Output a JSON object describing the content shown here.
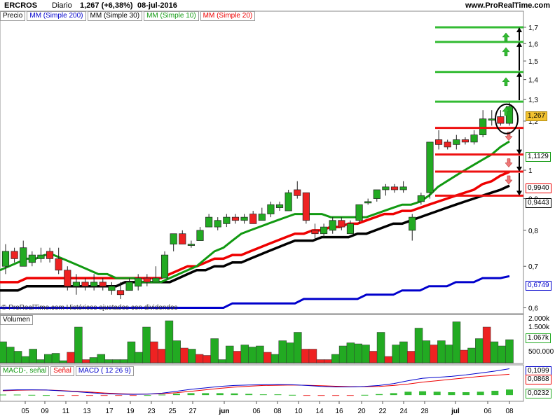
{
  "header": {
    "symbol": "ERCROS",
    "period": "Diario",
    "change": "1,267 (+6,38%)",
    "date": "08-jul-2016",
    "site": "www.ProRealTime.com"
  },
  "legend": {
    "price": "Precio",
    "mm200": "MM (Simple 200)",
    "mm30": "MM (Simple 30)",
    "mm10": "MM (Simple 10)",
    "mm20": "MM (Simple 20)"
  },
  "watermark": "© ProRealTime.com Históricos ajustados con dividendos",
  "volume_label": "Volumen",
  "macd_labels": {
    "a": "MACD-, señal",
    "b": "Señal",
    "c": "MACD ( 12 26 9)"
  },
  "price_tags": {
    "last": "1,267",
    "mm10": "1,1129",
    "mm20": "0,9940",
    "mm30": "0,9443",
    "mm200": "0,6749"
  },
  "volume_tags": [
    "2.000k",
    "1.500k",
    "1.067k",
    "500.000"
  ],
  "macd_tags": [
    "0,1099",
    "0,0868",
    "0,0232"
  ],
  "colors": {
    "up": "#22aa22",
    "down": "#ee2222",
    "mm200": "#0000cc",
    "mm30": "#000000",
    "mm10": "#119911",
    "mm20": "#ee0000",
    "last_tag": "#f2c230"
  },
  "chart_data": {
    "type": "candlestick",
    "title": "ERCROS Diario",
    "ylim": [
      0.59,
      1.74
    ],
    "y_ticks": [
      0.6,
      0.7,
      0.8,
      0.9,
      1.0,
      1.2,
      1.3,
      1.4,
      1.5,
      1.6,
      1.7
    ],
    "y_tick_labels": [
      "0,6",
      "0,7",
      "0,8",
      "0,9",
      "1",
      "1,2",
      "1,3",
      "1,4",
      "1,5",
      "1,6",
      "1,7"
    ],
    "x_labels": [
      "05",
      "09",
      "11",
      "13",
      "17",
      "19",
      "23",
      "25",
      "27",
      "jun",
      "06",
      "08",
      "10",
      "14",
      "16",
      "20",
      "22",
      "24",
      "28",
      "jul",
      "06",
      "08"
    ],
    "candles": [
      {
        "o": 0.7,
        "h": 0.76,
        "l": 0.68,
        "c": 0.74
      },
      {
        "o": 0.74,
        "h": 0.75,
        "l": 0.71,
        "c": 0.72
      },
      {
        "o": 0.7,
        "h": 0.77,
        "l": 0.7,
        "c": 0.75
      },
      {
        "o": 0.71,
        "h": 0.74,
        "l": 0.7,
        "c": 0.73
      },
      {
        "o": 0.72,
        "h": 0.75,
        "l": 0.71,
        "c": 0.73
      },
      {
        "o": 0.74,
        "h": 0.75,
        "l": 0.71,
        "c": 0.72
      },
      {
        "o": 0.72,
        "h": 0.75,
        "l": 0.68,
        "c": 0.69
      },
      {
        "o": 0.69,
        "h": 0.7,
        "l": 0.64,
        "c": 0.65
      },
      {
        "o": 0.65,
        "h": 0.68,
        "l": 0.63,
        "c": 0.66
      },
      {
        "o": 0.66,
        "h": 0.67,
        "l": 0.64,
        "c": 0.65
      },
      {
        "o": 0.65,
        "h": 0.68,
        "l": 0.64,
        "c": 0.66
      },
      {
        "o": 0.66,
        "h": 0.67,
        "l": 0.64,
        "c": 0.65
      },
      {
        "o": 0.64,
        "h": 0.66,
        "l": 0.63,
        "c": 0.65
      },
      {
        "o": 0.64,
        "h": 0.66,
        "l": 0.62,
        "c": 0.63
      },
      {
        "o": 0.64,
        "h": 0.67,
        "l": 0.64,
        "c": 0.66
      },
      {
        "o": 0.65,
        "h": 0.68,
        "l": 0.64,
        "c": 0.67
      },
      {
        "o": 0.67,
        "h": 0.68,
        "l": 0.65,
        "c": 0.66
      },
      {
        "o": 0.66,
        "h": 0.7,
        "l": 0.66,
        "c": 0.67
      },
      {
        "o": 0.67,
        "h": 0.74,
        "l": 0.67,
        "c": 0.73
      },
      {
        "o": 0.76,
        "h": 0.79,
        "l": 0.74,
        "c": 0.79
      },
      {
        "o": 0.79,
        "h": 0.8,
        "l": 0.76,
        "c": 0.76
      },
      {
        "o": 0.76,
        "h": 0.77,
        "l": 0.75,
        "c": 0.76
      },
      {
        "o": 0.77,
        "h": 0.81,
        "l": 0.77,
        "c": 0.8
      },
      {
        "o": 0.81,
        "h": 0.85,
        "l": 0.81,
        "c": 0.84
      },
      {
        "o": 0.81,
        "h": 0.84,
        "l": 0.8,
        "c": 0.83
      },
      {
        "o": 0.82,
        "h": 0.85,
        "l": 0.81,
        "c": 0.84
      },
      {
        "o": 0.84,
        "h": 0.85,
        "l": 0.82,
        "c": 0.83
      },
      {
        "o": 0.83,
        "h": 0.85,
        "l": 0.82,
        "c": 0.84
      },
      {
        "o": 0.85,
        "h": 0.86,
        "l": 0.82,
        "c": 0.82
      },
      {
        "o": 0.83,
        "h": 0.87,
        "l": 0.83,
        "c": 0.85
      },
      {
        "o": 0.85,
        "h": 0.89,
        "l": 0.84,
        "c": 0.88
      },
      {
        "o": 0.87,
        "h": 0.89,
        "l": 0.86,
        "c": 0.88
      },
      {
        "o": 0.86,
        "h": 0.93,
        "l": 0.86,
        "c": 0.92
      },
      {
        "o": 0.93,
        "h": 0.96,
        "l": 0.9,
        "c": 0.91
      },
      {
        "o": 0.92,
        "h": 0.92,
        "l": 0.82,
        "c": 0.83
      },
      {
        "o": 0.8,
        "h": 0.82,
        "l": 0.77,
        "c": 0.79
      },
      {
        "o": 0.79,
        "h": 0.82,
        "l": 0.78,
        "c": 0.81
      },
      {
        "o": 0.8,
        "h": 0.84,
        "l": 0.79,
        "c": 0.83
      },
      {
        "o": 0.83,
        "h": 0.84,
        "l": 0.8,
        "c": 0.81
      },
      {
        "o": 0.79,
        "h": 0.83,
        "l": 0.79,
        "c": 0.82
      },
      {
        "o": 0.83,
        "h": 0.88,
        "l": 0.82,
        "c": 0.88
      },
      {
        "o": 0.89,
        "h": 0.9,
        "l": 0.88,
        "c": 0.89
      },
      {
        "o": 0.9,
        "h": 0.93,
        "l": 0.89,
        "c": 0.93
      },
      {
        "o": 0.93,
        "h": 0.95,
        "l": 0.91,
        "c": 0.94
      },
      {
        "o": 0.94,
        "h": 0.95,
        "l": 0.92,
        "c": 0.93
      },
      {
        "o": 0.93,
        "h": 0.96,
        "l": 0.92,
        "c": 0.94
      },
      {
        "o": 0.8,
        "h": 0.85,
        "l": 0.77,
        "c": 0.84
      },
      {
        "o": 0.89,
        "h": 0.92,
        "l": 0.88,
        "c": 0.91
      },
      {
        "o": 0.92,
        "h": 1.11,
        "l": 0.9,
        "c": 1.11
      },
      {
        "o": 1.12,
        "h": 1.16,
        "l": 1.08,
        "c": 1.1
      },
      {
        "o": 1.11,
        "h": 1.12,
        "l": 1.08,
        "c": 1.09
      },
      {
        "o": 1.1,
        "h": 1.14,
        "l": 1.08,
        "c": 1.12
      },
      {
        "o": 1.12,
        "h": 1.13,
        "l": 1.1,
        "c": 1.11
      },
      {
        "o": 1.11,
        "h": 1.16,
        "l": 1.1,
        "c": 1.14
      },
      {
        "o": 1.14,
        "h": 1.25,
        "l": 1.13,
        "c": 1.21
      },
      {
        "o": 1.21,
        "h": 1.25,
        "l": 1.18,
        "c": 1.21
      },
      {
        "o": 1.22,
        "h": 1.25,
        "l": 1.18,
        "c": 1.19
      },
      {
        "o": 1.19,
        "h": 1.29,
        "l": 1.18,
        "c": 1.267
      }
    ],
    "mm10": [
      0.69,
      0.7,
      0.71,
      0.72,
      0.72,
      0.73,
      0.73,
      0.72,
      0.71,
      0.7,
      0.69,
      0.68,
      0.68,
      0.67,
      0.67,
      0.67,
      0.66,
      0.66,
      0.66,
      0.67,
      0.68,
      0.69,
      0.7,
      0.72,
      0.74,
      0.75,
      0.77,
      0.79,
      0.8,
      0.81,
      0.82,
      0.83,
      0.84,
      0.85,
      0.85,
      0.85,
      0.85,
      0.84,
      0.84,
      0.84,
      0.84,
      0.84,
      0.85,
      0.86,
      0.87,
      0.88,
      0.88,
      0.89,
      0.91,
      0.94,
      0.96,
      0.98,
      1.0,
      1.02,
      1.04,
      1.06,
      1.09,
      1.1129
    ],
    "mm20": [
      0.66,
      0.66,
      0.66,
      0.67,
      0.67,
      0.67,
      0.67,
      0.67,
      0.67,
      0.67,
      0.67,
      0.67,
      0.67,
      0.67,
      0.67,
      0.67,
      0.67,
      0.67,
      0.67,
      0.68,
      0.69,
      0.7,
      0.7,
      0.71,
      0.72,
      0.72,
      0.73,
      0.73,
      0.74,
      0.75,
      0.76,
      0.77,
      0.78,
      0.79,
      0.79,
      0.8,
      0.8,
      0.81,
      0.81,
      0.82,
      0.82,
      0.83,
      0.84,
      0.85,
      0.85,
      0.86,
      0.86,
      0.87,
      0.88,
      0.89,
      0.9,
      0.91,
      0.92,
      0.93,
      0.95,
      0.96,
      0.98,
      0.994
    ],
    "mm30": [
      0.64,
      0.64,
      0.64,
      0.65,
      0.65,
      0.65,
      0.65,
      0.65,
      0.65,
      0.65,
      0.65,
      0.65,
      0.65,
      0.65,
      0.66,
      0.66,
      0.66,
      0.66,
      0.66,
      0.66,
      0.67,
      0.68,
      0.69,
      0.69,
      0.7,
      0.7,
      0.71,
      0.71,
      0.72,
      0.73,
      0.74,
      0.75,
      0.76,
      0.77,
      0.77,
      0.77,
      0.78,
      0.78,
      0.78,
      0.78,
      0.79,
      0.79,
      0.8,
      0.81,
      0.82,
      0.82,
      0.83,
      0.84,
      0.85,
      0.86,
      0.87,
      0.88,
      0.89,
      0.9,
      0.91,
      0.92,
      0.93,
      0.9443
    ],
    "mm200": [
      0.6,
      0.6,
      0.6,
      0.6,
      0.6,
      0.6,
      0.6,
      0.6,
      0.6,
      0.6,
      0.6,
      0.6,
      0.6,
      0.6,
      0.6,
      0.6,
      0.6,
      0.6,
      0.6,
      0.6,
      0.6,
      0.6,
      0.6,
      0.6,
      0.6,
      0.6,
      0.61,
      0.61,
      0.61,
      0.61,
      0.61,
      0.61,
      0.61,
      0.61,
      0.62,
      0.62,
      0.62,
      0.62,
      0.62,
      0.62,
      0.62,
      0.63,
      0.63,
      0.63,
      0.63,
      0.64,
      0.64,
      0.64,
      0.65,
      0.65,
      0.65,
      0.66,
      0.66,
      0.66,
      0.67,
      0.67,
      0.67,
      0.6749
    ],
    "resistance_levels": [
      1.7,
      1.61,
      1.44,
      1.29
    ],
    "support_levels": [
      1.17,
      1.06,
      0.995,
      0.91
    ],
    "volume": {
      "ylim": [
        0,
        2200
      ],
      "values": [
        1000,
        750,
        550,
        300,
        650,
        150,
        400,
        450,
        100,
        500,
        1700,
        150,
        250,
        400,
        150,
        150,
        150,
        1000,
        500,
        1700,
        1000,
        650,
        2000,
        1050,
        700,
        650,
        400,
        350,
        1150,
        150,
        800,
        550,
        850,
        750,
        800,
        500,
        400,
        1050,
        950,
        1450,
        650,
        650,
        150,
        150,
        400,
        800,
        950,
        900,
        850,
        550,
        1450,
        300,
        850,
        1000,
        550,
        1650,
        1050,
        850,
        1050,
        850,
        1950,
        600,
        700,
        1150,
        1700,
        1000,
        800,
        1100
      ],
      "ups": [
        1,
        1,
        1,
        1,
        1,
        1,
        1,
        1,
        1,
        0,
        1,
        0,
        1,
        1,
        1,
        1,
        1,
        1,
        1,
        1,
        0,
        0,
        1,
        1,
        0,
        1,
        0,
        0,
        1,
        1,
        1,
        0,
        1,
        1,
        1,
        0,
        1,
        1,
        1,
        1,
        0,
        0,
        0,
        0,
        1,
        1,
        1,
        1,
        1,
        0,
        1,
        0,
        1,
        1,
        0,
        1,
        1,
        0,
        1,
        1,
        1,
        0,
        1,
        1,
        0,
        1,
        1,
        1
      ]
    },
    "macd": {
      "macd_line": [
        0.02,
        0.022,
        0.022,
        0.021,
        0.018,
        0.014,
        0.01,
        0.006,
        0.004,
        0.003,
        0.004,
        0.008,
        0.016,
        0.024,
        0.03,
        0.036,
        0.04,
        0.042,
        0.043,
        0.044,
        0.043,
        0.04,
        0.036,
        0.034,
        0.034,
        0.036,
        0.04,
        0.048,
        0.06,
        0.07,
        0.074,
        0.078,
        0.084,
        0.092,
        0.1,
        0.1099
      ],
      "signal_line": [
        0.018,
        0.02,
        0.021,
        0.021,
        0.019,
        0.016,
        0.013,
        0.009,
        0.006,
        0.004,
        0.004,
        0.006,
        0.01,
        0.016,
        0.022,
        0.028,
        0.033,
        0.037,
        0.04,
        0.041,
        0.042,
        0.041,
        0.039,
        0.037,
        0.035,
        0.035,
        0.036,
        0.04,
        0.046,
        0.054,
        0.06,
        0.066,
        0.072,
        0.078,
        0.082,
        0.0868
      ],
      "histogram": [
        0.002,
        0.002,
        0.001,
        0.0,
        -0.001,
        -0.002,
        -0.003,
        -0.003,
        -0.002,
        -0.001,
        0.0,
        0.002,
        0.006,
        0.008,
        0.008,
        0.008,
        0.007,
        0.005,
        0.003,
        0.003,
        0.001,
        -0.001,
        -0.003,
        -0.003,
        -0.001,
        0.001,
        0.004,
        0.008,
        0.014,
        0.016,
        0.014,
        0.012,
        0.012,
        0.014,
        0.018,
        0.0232
      ],
      "ylim": [
        -0.02,
        0.12
      ]
    }
  }
}
